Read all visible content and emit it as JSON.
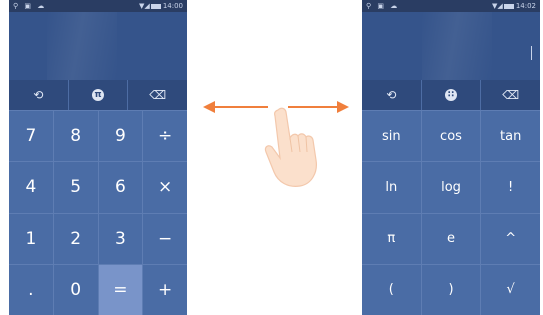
{
  "left_phone": {
    "status": {
      "icons_left": "⚲ ▣ ☁",
      "time": "14:00"
    },
    "function_buttons": [
      {
        "icon": "history-icon",
        "glyph": "⟲"
      },
      {
        "icon": "pi-icon",
        "glyph": "π"
      },
      {
        "icon": "backspace-icon",
        "glyph": "⌫"
      }
    ],
    "keys": [
      "7",
      "8",
      "9",
      "÷",
      "4",
      "5",
      "6",
      "×",
      "1",
      "2",
      "3",
      "−",
      ".",
      "0",
      "=",
      "+"
    ]
  },
  "right_phone": {
    "status": {
      "icons_left": "⚲ ▣ ☁",
      "time": "14:02"
    },
    "function_buttons": [
      {
        "icon": "history-icon",
        "glyph": "⟲"
      },
      {
        "icon": "digits-icon",
        "glyph": "∷"
      },
      {
        "icon": "backspace-icon",
        "glyph": "⌫"
      }
    ],
    "keys": [
      "sin",
      "cos",
      "tan",
      "ln",
      "log",
      "!",
      "π",
      "e",
      "^",
      "(",
      ")",
      "√"
    ]
  },
  "gesture": {
    "icon": "swipe-hand-icon",
    "arrow": "double-headed-arrow",
    "color": "#f07f3c"
  },
  "colors": {
    "panel": "#4a6ca5",
    "display": "#35548b",
    "statusbar": "#2a3d63",
    "equals": "#7994c9"
  }
}
